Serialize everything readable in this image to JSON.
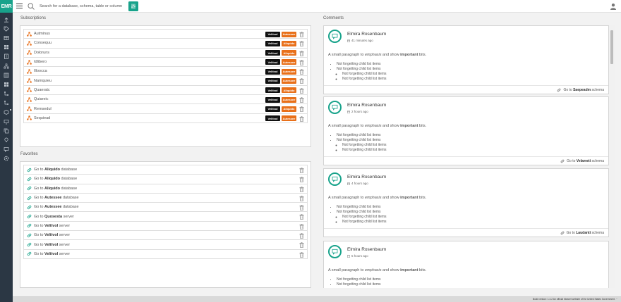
{
  "app": {
    "logo_text": "EMR",
    "search_placeholder": "Search for a database, schema, table or column"
  },
  "subscriptions": {
    "title": "Subscriptions",
    "items": [
      {
        "label": "Autminus",
        "badge1": "Velitvol",
        "badge2": "Autessee"
      },
      {
        "label": "Consequu",
        "badge1": "Velitvol",
        "badge2": "Aliquido"
      },
      {
        "label": "Doloruns",
        "badge1": "Velitvol",
        "badge2": "Aliquido"
      },
      {
        "label": "Idlibero",
        "badge1": "Velitvol",
        "badge2": "Autessee"
      },
      {
        "label": "Illoocca",
        "badge1": "Velitvol",
        "badge2": "Autessee"
      },
      {
        "label": "Namquieu",
        "badge1": "Velitvol",
        "badge2": "Autessee"
      },
      {
        "label": "Quaeratc",
        "badge1": "Velitvol",
        "badge2": "Aliquido"
      },
      {
        "label": "Quiareic",
        "badge1": "Velitvol",
        "badge2": "Autessee"
      },
      {
        "label": "Remsedul",
        "badge1": "Velitvol",
        "badge2": "Aliquido"
      },
      {
        "label": "Sequiead",
        "badge1": "Velitvol",
        "badge2": "Autessee"
      }
    ]
  },
  "favorites": {
    "title": "Favorites",
    "items": [
      {
        "prefix": "Go to",
        "name": "Aliquido",
        "type": "database"
      },
      {
        "prefix": "Go to",
        "name": "Aliquido",
        "type": "database"
      },
      {
        "prefix": "Go to",
        "name": "Aliquido",
        "type": "database"
      },
      {
        "prefix": "Go to",
        "name": "Autessee",
        "type": "database"
      },
      {
        "prefix": "Go to",
        "name": "Autessee",
        "type": "database"
      },
      {
        "prefix": "Go to",
        "name": "Quosesta",
        "type": "server"
      },
      {
        "prefix": "Go to",
        "name": "Velitvol",
        "type": "server"
      },
      {
        "prefix": "Go to",
        "name": "Velitvol",
        "type": "server"
      },
      {
        "prefix": "Go to",
        "name": "Velitvol",
        "type": "server"
      },
      {
        "prefix": "Go to",
        "name": "Velitvol",
        "type": "server"
      }
    ]
  },
  "comments": {
    "title": "Comments",
    "items": [
      {
        "author": "Elmira Rosenbaum",
        "time": "41 minutes ago",
        "para_1": "A small paragraph to ",
        "para_em": "emphasis",
        "para_2": " and show ",
        "para_strong": "important",
        "para_3": " bits.",
        "list_1": "Not forgetting child list items",
        "list_2": "Not forgetting child list items",
        "sub_1": "Not forgetting child list items",
        "sub_2": "Not forgetting child list items",
        "link_prefix": "Go to",
        "link_name": "Saepeadm",
        "link_type": "schema"
      },
      {
        "author": "Elmira Rosenbaum",
        "time": "2 hours ago",
        "para_1": "A small paragraph to ",
        "para_em": "emphasis",
        "para_2": " and show ",
        "para_strong": "important",
        "para_3": " bits.",
        "list_1": "Not forgetting child list items",
        "list_2": "Not forgetting child list items",
        "sub_1": "Not forgetting child list items",
        "sub_2": "Not forgetting child list items",
        "link_prefix": "Go to",
        "link_name": "Velameti",
        "link_type": "schema"
      },
      {
        "author": "Elmira Rosenbaum",
        "time": "4 hours ago",
        "para_1": "A small paragraph to ",
        "para_em": "emphasis",
        "para_2": " and show ",
        "para_strong": "important",
        "para_3": " bits.",
        "list_1": "Not forgetting child list items",
        "list_2": "Not forgetting child list items",
        "sub_1": "Not forgetting child list items",
        "sub_2": "Not forgetting child list items",
        "link_prefix": "Go to",
        "link_name": "Laudanti",
        "link_type": "schema"
      },
      {
        "author": "Elmira Rosenbaum",
        "time": "5 hours ago",
        "para_1": "A small paragraph to ",
        "para_em": "emphasis",
        "para_2": " and show ",
        "para_strong": "important",
        "para_3": " bits.",
        "list_1": "Not forgetting child list items",
        "list_2": "Not forgetting child list items",
        "sub_1": "",
        "sub_2": "",
        "link_prefix": "",
        "link_name": "",
        "link_type": ""
      }
    ]
  },
  "footer": {
    "text": "Build version: 1.4.2 An official intranet website of the United States Government. ··"
  },
  "colors": {
    "accent": "#18a38b",
    "sidebar": "#2b3744",
    "orange": "#e8701a",
    "badge_dark": "#111111"
  }
}
